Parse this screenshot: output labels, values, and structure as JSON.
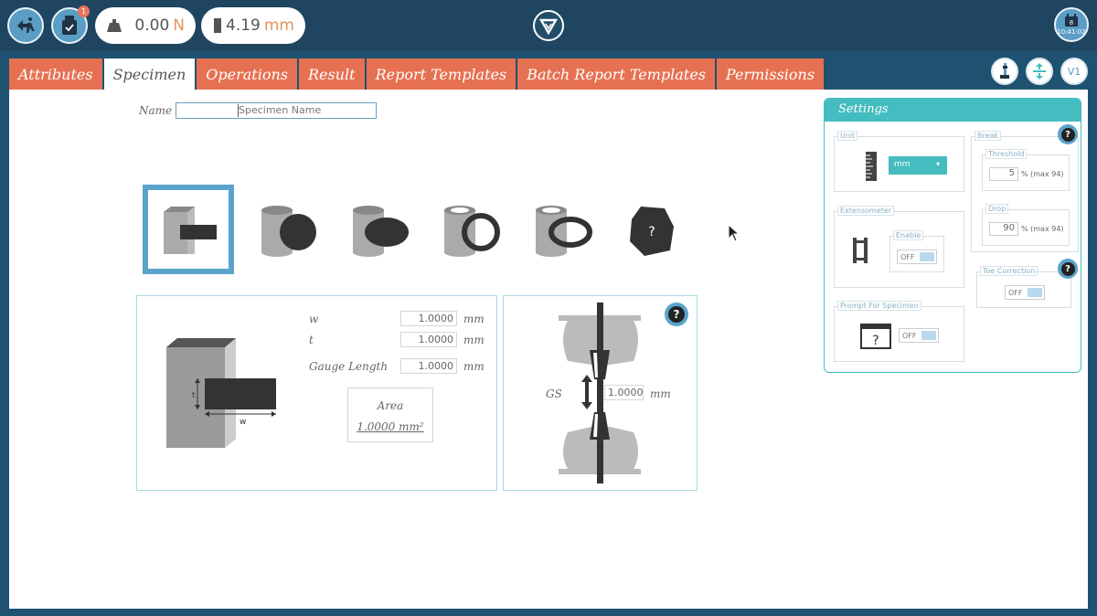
{
  "topbar": {
    "exit_badge": "",
    "usb_badge": "1",
    "force_value": "0.00",
    "force_unit": "N",
    "position_value": "4.19",
    "position_unit": "mm",
    "clock_day": "8",
    "clock_time": "10:41:02"
  },
  "tabs": [
    {
      "label": "Attributes",
      "active": false
    },
    {
      "label": "Specimen",
      "active": true
    },
    {
      "label": "Operations",
      "active": false
    },
    {
      "label": "Result",
      "active": false
    },
    {
      "label": "Report Templates",
      "active": false
    },
    {
      "label": "Batch Report Templates",
      "active": false
    },
    {
      "label": "Permissions",
      "active": false
    }
  ],
  "toolbar": {
    "version_label": "V1"
  },
  "specimen": {
    "name_label": "Name",
    "name_placeholder": "Specimen Name",
    "shapes": [
      {
        "icon": "rectangular-specimen-icon",
        "selected": true
      },
      {
        "icon": "round-specimen-icon",
        "selected": false
      },
      {
        "icon": "oval-specimen-icon",
        "selected": false
      },
      {
        "icon": "tube-specimen-icon",
        "selected": false
      },
      {
        "icon": "oval-tube-specimen-icon",
        "selected": false
      },
      {
        "icon": "irregular-specimen-icon",
        "selected": false,
        "glyph": "?"
      }
    ],
    "diagram_t_label": "t",
    "diagram_w_label": "w",
    "fields": [
      {
        "label": "w",
        "value": "1.0000",
        "unit": "mm"
      },
      {
        "label": "t",
        "value": "1.0000",
        "unit": "mm"
      },
      {
        "label": "Gauge Length",
        "value": "1.0000",
        "unit": "mm"
      }
    ],
    "area_label": "Area",
    "area_value": "1.0000 mm²",
    "grip": {
      "gs_label": "GS",
      "gs_value": "1.0000",
      "gs_unit": "mm",
      "help": "?"
    }
  },
  "settings": {
    "title": "Settings",
    "unit": {
      "label": "Unit",
      "selected": "mm"
    },
    "extensometer": {
      "label": "Extensometer",
      "enable_label": "Enable",
      "state": "OFF"
    },
    "prompt": {
      "label": "Prompt For Specimen",
      "state": "OFF",
      "glyph": "?"
    },
    "break": {
      "label": "Break",
      "help": "?",
      "threshold_label": "Threshold",
      "threshold_value": "5",
      "threshold_note": "% (max 94)",
      "drop_label": "Drop",
      "drop_value": "90",
      "drop_note": "% (max 94)"
    },
    "toe": {
      "label": "Toe Correction",
      "help": "?",
      "state": "OFF"
    }
  }
}
